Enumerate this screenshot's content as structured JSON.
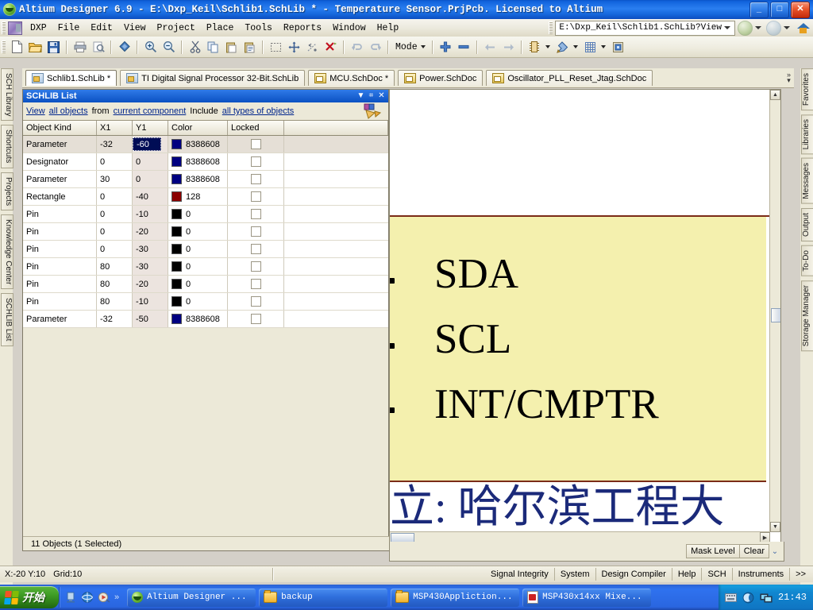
{
  "window": {
    "title": "Altium Designer 6.9 - E:\\Dxp_Keil\\Schlib1.SchLib * - Temperature Sensor.PrjPcb. Licensed to Altium",
    "minimize_label": "_",
    "maximize_label": "□",
    "close_label": "✕"
  },
  "menu": {
    "items": [
      "DXP",
      "File",
      "Edit",
      "View",
      "Project",
      "Place",
      "Tools",
      "Reports",
      "Window",
      "Help"
    ],
    "address_value": "E:\\Dxp_Keil\\Schlib1.SchLib?View"
  },
  "toolbar": {
    "mode_label": "Mode",
    "icons": [
      "new-document-icon",
      "open-folder-icon",
      "save-icon",
      "print-icon",
      "print-preview-icon",
      "board-icon",
      "zoom-in-icon",
      "zoom-out-icon",
      "cut-icon",
      "copy-icon",
      "paste-icon",
      "paste-special-icon",
      "select-area-icon",
      "move-icon",
      "deselect-icon",
      "clear-selection-icon",
      "undo-icon",
      "redo-icon",
      "mode-dropdown",
      "add-part-icon",
      "remove-part-icon",
      "prev-part-icon",
      "next-part-icon",
      "component-icon",
      "drawing-tools-icon",
      "grid-icon",
      "ide-icon"
    ]
  },
  "doc_tabs": [
    {
      "label": "Schlib1.SchLib *",
      "icon": "schlib-icon",
      "active": true
    },
    {
      "label": "TI Digital Signal Processor 32-Bit.SchLib",
      "icon": "schlib-icon",
      "active": false
    },
    {
      "label": "MCU.SchDoc *",
      "icon": "schdoc-icon",
      "active": false
    },
    {
      "label": "Power.SchDoc",
      "icon": "schdoc-icon",
      "active": false
    },
    {
      "label": "Oscillator_PLL_Reset_Jtag.SchDoc",
      "icon": "schdoc-icon",
      "active": false
    }
  ],
  "left_tabs": [
    "SCH Library",
    "Shortcuts",
    "Projects",
    "Knowledge Center",
    "SCHLIB List"
  ],
  "right_tabs": [
    "Favorites",
    "Libraries",
    "Messages",
    "Output",
    "To-Do",
    "Storage Manager"
  ],
  "panel": {
    "title": "SCHLIB List",
    "dropdown_icon": "chevron-down-icon",
    "pin_icon": "pin-icon",
    "close_icon": "close-icon",
    "filter": {
      "view_label": "View",
      "scope_link": "all objects",
      "from_label": "from",
      "source_link": "current component",
      "include_label": "Include",
      "types_link": "all types of objects"
    },
    "columns": [
      "Object Kind",
      "X1",
      "Y1",
      "Color",
      "Locked"
    ],
    "rows": [
      {
        "kind": "Parameter",
        "x1": "-32",
        "y1": "-60",
        "color_value": "8388608",
        "color_hex": "#000080",
        "locked": false,
        "selected": true,
        "editing": true
      },
      {
        "kind": "Designator",
        "x1": "0",
        "y1": "0",
        "color_value": "8388608",
        "color_hex": "#000080",
        "locked": false,
        "selected": false,
        "editing": false
      },
      {
        "kind": "Parameter",
        "x1": "30",
        "y1": "0",
        "color_value": "8388608",
        "color_hex": "#000080",
        "locked": false,
        "selected": false,
        "editing": false
      },
      {
        "kind": "Rectangle",
        "x1": "0",
        "y1": "-40",
        "color_value": "128",
        "color_hex": "#8b0000",
        "locked": false,
        "selected": false,
        "editing": false
      },
      {
        "kind": "Pin",
        "x1": "0",
        "y1": "-10",
        "color_value": "0",
        "color_hex": "#000000",
        "locked": false,
        "selected": false,
        "editing": false
      },
      {
        "kind": "Pin",
        "x1": "0",
        "y1": "-20",
        "color_value": "0",
        "color_hex": "#000000",
        "locked": false,
        "selected": false,
        "editing": false
      },
      {
        "kind": "Pin",
        "x1": "0",
        "y1": "-30",
        "color_value": "0",
        "color_hex": "#000000",
        "locked": false,
        "selected": false,
        "editing": false
      },
      {
        "kind": "Pin",
        "x1": "80",
        "y1": "-30",
        "color_value": "0",
        "color_hex": "#000000",
        "locked": false,
        "selected": false,
        "editing": false
      },
      {
        "kind": "Pin",
        "x1": "80",
        "y1": "-20",
        "color_value": "0",
        "color_hex": "#000000",
        "locked": false,
        "selected": false,
        "editing": false
      },
      {
        "kind": "Pin",
        "x1": "80",
        "y1": "-10",
        "color_value": "0",
        "color_hex": "#000000",
        "locked": false,
        "selected": false,
        "editing": false
      },
      {
        "kind": "Parameter",
        "x1": "-32",
        "y1": "-50",
        "color_value": "8388608",
        "color_hex": "#000080",
        "locked": false,
        "selected": false,
        "editing": false
      }
    ],
    "status": "11 Objects (1 Selected)"
  },
  "canvas": {
    "net_labels": [
      "SDA",
      "SCL",
      "INT/CMPTR"
    ],
    "chinese_text": "立: 哈尔滨工程大",
    "sheet_border_color": "#7b2b18",
    "body_color": "#f4f0ae"
  },
  "mask_bar": {
    "mask_level_label": "Mask Level",
    "clear_label": "Clear"
  },
  "statusbar": {
    "coordinates": "X:-20 Y:10",
    "grid": "Grid:10",
    "panels": [
      "Signal Integrity",
      "System",
      "Design Compiler",
      "Help",
      "SCH",
      "Instruments"
    ],
    "more_label": ">>"
  },
  "taskbar": {
    "start_label": "开始",
    "quick_launch": [
      "show-desktop-icon",
      "ie-icon",
      "media-player-icon",
      "chevron-right-icon"
    ],
    "items": [
      {
        "label": "Altium Designer ...",
        "icon": "altium-icon"
      },
      {
        "label": "backup",
        "icon": "folder-icon"
      },
      {
        "label": "MSP430Appliction...",
        "icon": "folder-icon"
      },
      {
        "label": "MSP430x14xx Mixe...",
        "icon": "pdf-icon"
      }
    ],
    "tray_icons": [
      "keyboard-icon",
      "shield-icon",
      "network-icon"
    ],
    "clock": "21:43"
  }
}
